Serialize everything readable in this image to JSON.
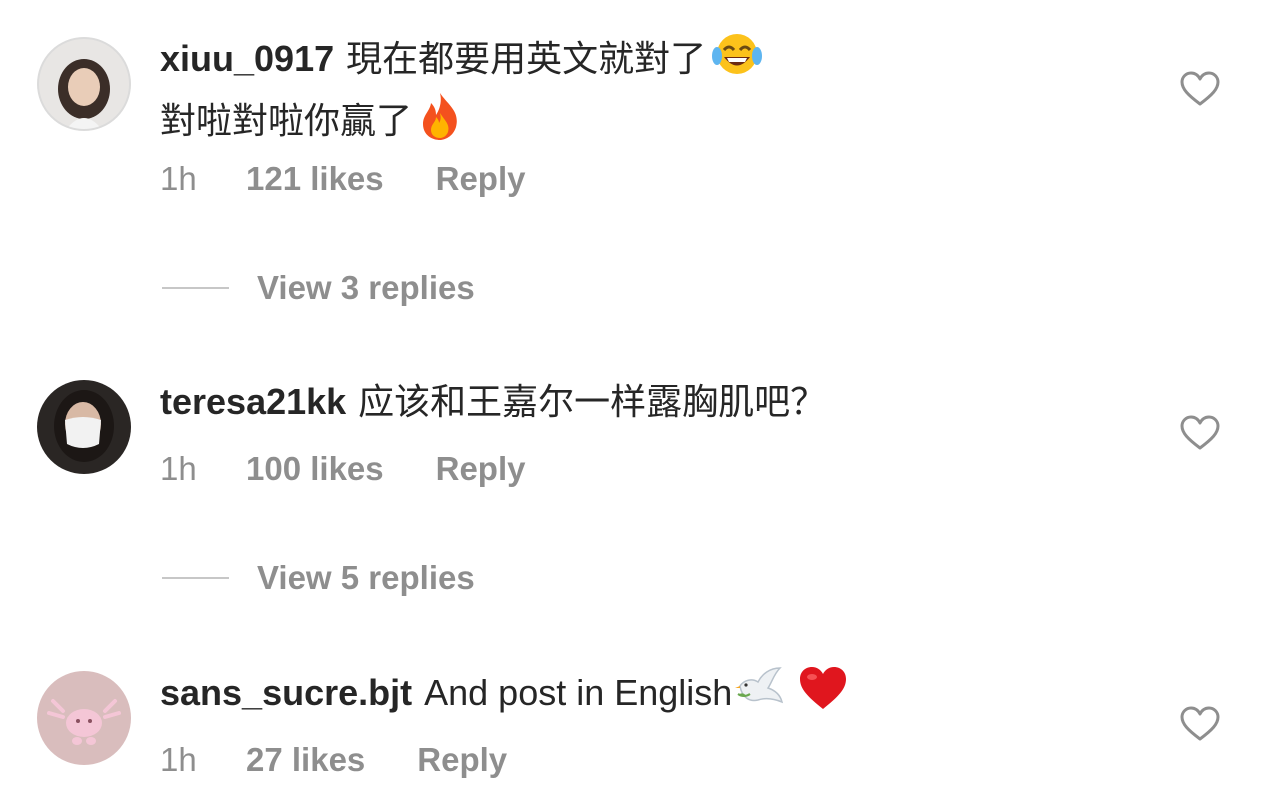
{
  "comments": [
    {
      "username": "xiuu_0917",
      "text_line1": "現在都要用英文就對了",
      "emoji_line1": "face-with-tears-of-joy",
      "text_line2": "對啦對啦你贏了",
      "emoji_line2": "fire",
      "time": "1h",
      "likes": "121 likes",
      "reply": "Reply",
      "view_replies": "View 3 replies"
    },
    {
      "username": "teresa21kk",
      "text_line1": "应该和王嘉尔一样露胸肌吧？",
      "time": "1h",
      "likes": "100 likes",
      "reply": "Reply",
      "view_replies": "View 5 replies"
    },
    {
      "username": "sans_sucre.bjt",
      "text_line1": "And post in English",
      "emoji_line1": "dove",
      "emoji_line1b": "red-heart",
      "time": "1h",
      "likes": "27 likes",
      "reply": "Reply"
    }
  ],
  "colors": {
    "text": "#262626",
    "secondary": "#8e8e8e",
    "divider": "#c7c7c7"
  },
  "icons": {
    "like": "heart-outline-icon"
  }
}
